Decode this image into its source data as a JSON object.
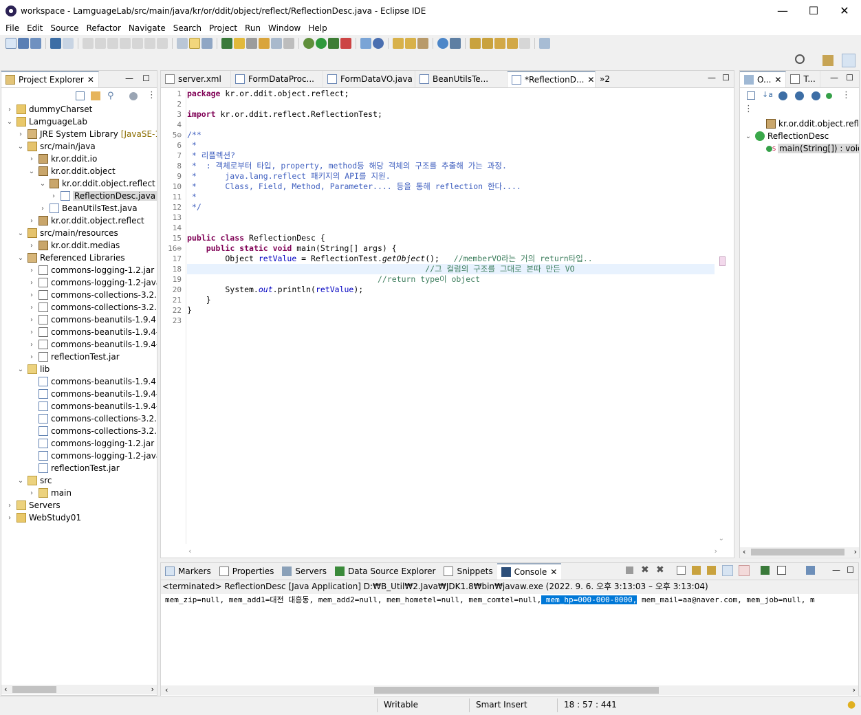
{
  "window": {
    "title": "workspace - LamguageLab/src/main/java/kr/or/ddit/object/reflect/ReflectionDesc.java - Eclipse IDE",
    "minimize": "—",
    "maximize": "☐",
    "close": "✕"
  },
  "menu": [
    "File",
    "Edit",
    "Source",
    "Refactor",
    "Navigate",
    "Search",
    "Project",
    "Run",
    "Window",
    "Help"
  ],
  "project_explorer": {
    "tab_label": "Project Explorer",
    "items": [
      {
        "indent": 0,
        "twisty": "›",
        "icon": "project-folder-icon",
        "label": "dummyCharset"
      },
      {
        "indent": 0,
        "twisty": "⌄",
        "icon": "project-folder-icon",
        "label": "LamguageLab"
      },
      {
        "indent": 1,
        "twisty": "›",
        "icon": "library-icon",
        "label": "JRE System Library",
        "sub": "[JavaSE-1.8]"
      },
      {
        "indent": 1,
        "twisty": "⌄",
        "icon": "source-folder-icon",
        "label": "src/main/java"
      },
      {
        "indent": 2,
        "twisty": "›",
        "icon": "package-icon",
        "label": "kr.or.ddit.io"
      },
      {
        "indent": 2,
        "twisty": "⌄",
        "icon": "package-icon",
        "label": "kr.or.ddit.object"
      },
      {
        "indent": 3,
        "twisty": "⌄",
        "icon": "package-icon",
        "label": "kr.or.ddit.object.reflect"
      },
      {
        "indent": 4,
        "twisty": "›",
        "icon": "java-file-icon",
        "label": "ReflectionDesc.java",
        "selected": true
      },
      {
        "indent": 3,
        "twisty": "›",
        "icon": "java-file-icon",
        "label": "BeanUtilsTest.java"
      },
      {
        "indent": 2,
        "twisty": "›",
        "icon": "package-icon",
        "label": "kr.or.ddit.object.reflect"
      },
      {
        "indent": 1,
        "twisty": "⌄",
        "icon": "source-folder-icon",
        "label": "src/main/resources"
      },
      {
        "indent": 2,
        "twisty": "›",
        "icon": "package-icon",
        "label": "kr.or.ddit.medias"
      },
      {
        "indent": 1,
        "twisty": "⌄",
        "icon": "library-icon",
        "label": "Referenced Libraries"
      },
      {
        "indent": 2,
        "twisty": "›",
        "icon": "jar-icon",
        "label": "commons-logging-1.2.jar - "
      },
      {
        "indent": 2,
        "twisty": "›",
        "icon": "jar-icon",
        "label": "commons-logging-1.2-javad"
      },
      {
        "indent": 2,
        "twisty": "›",
        "icon": "jar-icon",
        "label": "commons-collections-3.2.2.j"
      },
      {
        "indent": 2,
        "twisty": "›",
        "icon": "jar-icon",
        "label": "commons-collections-3.2.2-"
      },
      {
        "indent": 2,
        "twisty": "›",
        "icon": "jar-icon",
        "label": "commons-beanutils-1.9.4.jar"
      },
      {
        "indent": 2,
        "twisty": "›",
        "icon": "jar-icon",
        "label": "commons-beanutils-1.9.4-ja"
      },
      {
        "indent": 2,
        "twisty": "›",
        "icon": "jar-icon",
        "label": "commons-beanutils-1.9.4-sc"
      },
      {
        "indent": 2,
        "twisty": "›",
        "icon": "jar-icon",
        "label": "reflectionTest.jar"
      },
      {
        "indent": 1,
        "twisty": "⌄",
        "icon": "folder-icon",
        "label": "lib"
      },
      {
        "indent": 2,
        "twisty": "",
        "icon": "jar-file-icon",
        "label": "commons-beanutils-1.9.4.jar"
      },
      {
        "indent": 2,
        "twisty": "",
        "icon": "jar-file-icon",
        "label": "commons-beanutils-1.9.4-ja"
      },
      {
        "indent": 2,
        "twisty": "",
        "icon": "jar-file-icon",
        "label": "commons-beanutils-1.9.4-sc"
      },
      {
        "indent": 2,
        "twisty": "",
        "icon": "jar-file-icon",
        "label": "commons-collections-3.2.2.j"
      },
      {
        "indent": 2,
        "twisty": "",
        "icon": "jar-file-icon",
        "label": "commons-collections-3.2.2-"
      },
      {
        "indent": 2,
        "twisty": "",
        "icon": "jar-file-icon",
        "label": "commons-logging-1.2.jar"
      },
      {
        "indent": 2,
        "twisty": "",
        "icon": "jar-file-icon",
        "label": "commons-logging-1.2-javad"
      },
      {
        "indent": 2,
        "twisty": "",
        "icon": "jar-file-icon",
        "label": "reflectionTest.jar"
      },
      {
        "indent": 1,
        "twisty": "⌄",
        "icon": "folder-icon",
        "label": "src"
      },
      {
        "indent": 2,
        "twisty": "›",
        "icon": "folder-icon",
        "label": "main"
      },
      {
        "indent": 0,
        "twisty": "›",
        "icon": "folder-icon",
        "label": "Servers"
      },
      {
        "indent": 0,
        "twisty": "›",
        "icon": "project-folder-icon",
        "label": "WebStudy01"
      }
    ]
  },
  "editor": {
    "tabs": [
      {
        "icon": "xml-file-icon",
        "label": "server.xml"
      },
      {
        "icon": "java-file-icon",
        "label": "FormDataProc..."
      },
      {
        "icon": "java-file-icon",
        "label": "FormDataVO.java"
      },
      {
        "icon": "java-file-icon",
        "label": "BeanUtilsTe..."
      },
      {
        "icon": "java-file-icon",
        "label": "*ReflectionD...",
        "active": true
      }
    ],
    "overflow": "»2",
    "line_numbers": [
      "1",
      "2",
      "3",
      "4",
      "5⊖",
      "6",
      "7",
      "8",
      "9",
      "10",
      "11",
      "12",
      "13",
      "14",
      "15",
      "16⊖",
      "17",
      "18",
      "19",
      "20",
      "21",
      "22",
      "23"
    ],
    "lines": [
      [
        {
          "c": "kw",
          "t": "package"
        },
        {
          "c": "",
          "t": " kr.or.ddit.object.reflect;"
        }
      ],
      [],
      [
        {
          "c": "kw",
          "t": "import"
        },
        {
          "c": "",
          "t": " kr.or.ddit.reflect.ReflectionTest;"
        }
      ],
      [],
      [
        {
          "c": "cm",
          "t": "/**"
        }
      ],
      [
        {
          "c": "cm",
          "t": " *"
        }
      ],
      [
        {
          "c": "cm",
          "t": " * 리플렉션?"
        }
      ],
      [
        {
          "c": "cm",
          "t": " *  : 객체로부터 타입, property, method등 해당 객체의 구조를 추출해 가는 과정."
        }
      ],
      [
        {
          "c": "cm",
          "t": " *      java.lang.reflect 패키지의 API를 지원."
        }
      ],
      [
        {
          "c": "cm",
          "t": " *      Class, Field, Method, Parameter.... 등을 통해 reflection 한다...."
        }
      ],
      [
        {
          "c": "cm",
          "t": " *"
        }
      ],
      [
        {
          "c": "cm",
          "t": " */"
        }
      ],
      [],
      [],
      [
        {
          "c": "kw",
          "t": "public class"
        },
        {
          "c": "",
          "t": " ReflectionDesc {"
        }
      ],
      [
        {
          "c": "",
          "t": "    "
        },
        {
          "c": "kw",
          "t": "public static void"
        },
        {
          "c": "",
          "t": " main(String[] args) {"
        }
      ],
      [
        {
          "c": "",
          "t": "        Object "
        },
        {
          "c": "fd",
          "t": "retValue"
        },
        {
          "c": "",
          "t": " = ReflectionTest."
        },
        {
          "c": "st",
          "t": "getObject"
        },
        {
          "c": "",
          "t": "();   "
        },
        {
          "c": "lc",
          "t": "//memberVO라는 거의 return타입.."
        }
      ],
      [
        {
          "c": "",
          "t": "                                                  "
        },
        {
          "c": "lc",
          "t": "//그 컬럼의 구조를 그대로 본따 만든 VO"
        }
      ],
      [
        {
          "c": "",
          "t": "                                        "
        },
        {
          "c": "lc",
          "t": "//return type이 object"
        }
      ],
      [
        {
          "c": "",
          "t": "        System."
        },
        {
          "c": "fd st",
          "t": "out"
        },
        {
          "c": "",
          "t": ".println("
        },
        {
          "c": "fd",
          "t": "retValue"
        },
        {
          "c": "",
          "t": ");"
        }
      ],
      [
        {
          "c": "",
          "t": "    }"
        }
      ],
      [
        {
          "c": "",
          "t": "}"
        }
      ],
      []
    ]
  },
  "outline": {
    "tabs": [
      {
        "label": "O..."
      },
      {
        "label": "T..."
      }
    ],
    "items": [
      {
        "indent": 1,
        "twisty": "",
        "icon": "package-icon",
        "label": "kr.or.ddit.object.reflect"
      },
      {
        "indent": 0,
        "twisty": "⌄",
        "icon": "class-icon",
        "label": "ReflectionDesc"
      },
      {
        "indent": 1,
        "twisty": "",
        "icon": "method-icon",
        "label": "main(String[]) : void",
        "sup": "S",
        "selected": true
      }
    ]
  },
  "console": {
    "tabs": [
      {
        "icon": "markers-icon",
        "label": "Markers"
      },
      {
        "icon": "properties-icon",
        "label": "Properties"
      },
      {
        "icon": "servers-icon",
        "label": "Servers"
      },
      {
        "icon": "datasource-icon",
        "label": "Data Source Explorer"
      },
      {
        "icon": "snippets-icon",
        "label": "Snippets"
      },
      {
        "icon": "console-icon",
        "label": "Console",
        "active": true
      }
    ],
    "status": "<terminated> ReflectionDesc [Java Application] D:₩B_Util₩2.Java₩JDK1.8₩bin₩javaw.exe  (2022. 9. 6. 오후 3:13:03 – 오후 3:13:04)",
    "output_before": "mem_zip=null, mem_add1=대전 대흥동, mem_add2=null, mem_hometel=null, mem_comtel=null,",
    "output_selected": " mem_hp=000-000-0000,",
    "output_after": " mem_mail=aa@naver.com, mem_job=null, m"
  },
  "statusbar": {
    "writable": "Writable",
    "insert_mode": "Smart Insert",
    "position": "18 : 57 : 441"
  },
  "colors": {
    "selection": "#0078d7",
    "keyword": "#7f0055",
    "javadoc": "#3f5fbf",
    "comment": "#3f7f5f",
    "field": "#0000c0"
  }
}
